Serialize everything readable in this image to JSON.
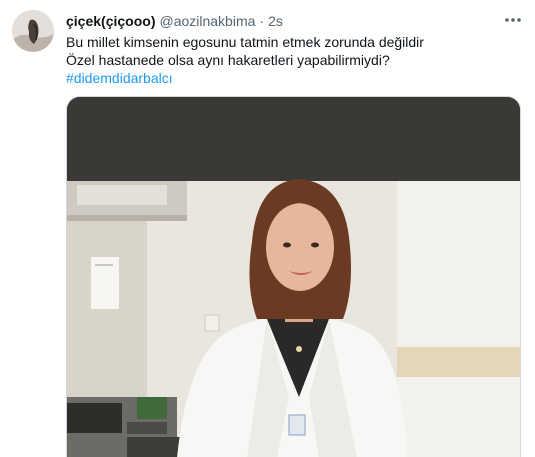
{
  "tweet": {
    "author": {
      "display_name": "çiçek(çiçooo)",
      "handle": "@aozilnakbima",
      "separator": "·",
      "time": "2s"
    },
    "text_lines": [
      "Bu millet kimsenin egosunu tatmin etmek zorunda değildir",
      "Özel hastanede olsa aynı hakaretleri yapabilirmiydi?"
    ],
    "hashtag": "#didemdidarbalcı",
    "media": {
      "description_icon": "photo",
      "background_dark": "#3a3936"
    },
    "icons": {
      "more": "more-horizontal-icon",
      "avatar": "avatar"
    }
  },
  "colors": {
    "text": "#0f1419",
    "secondary": "#536471",
    "link": "#1d9bf0",
    "border": "#cfd9de"
  }
}
